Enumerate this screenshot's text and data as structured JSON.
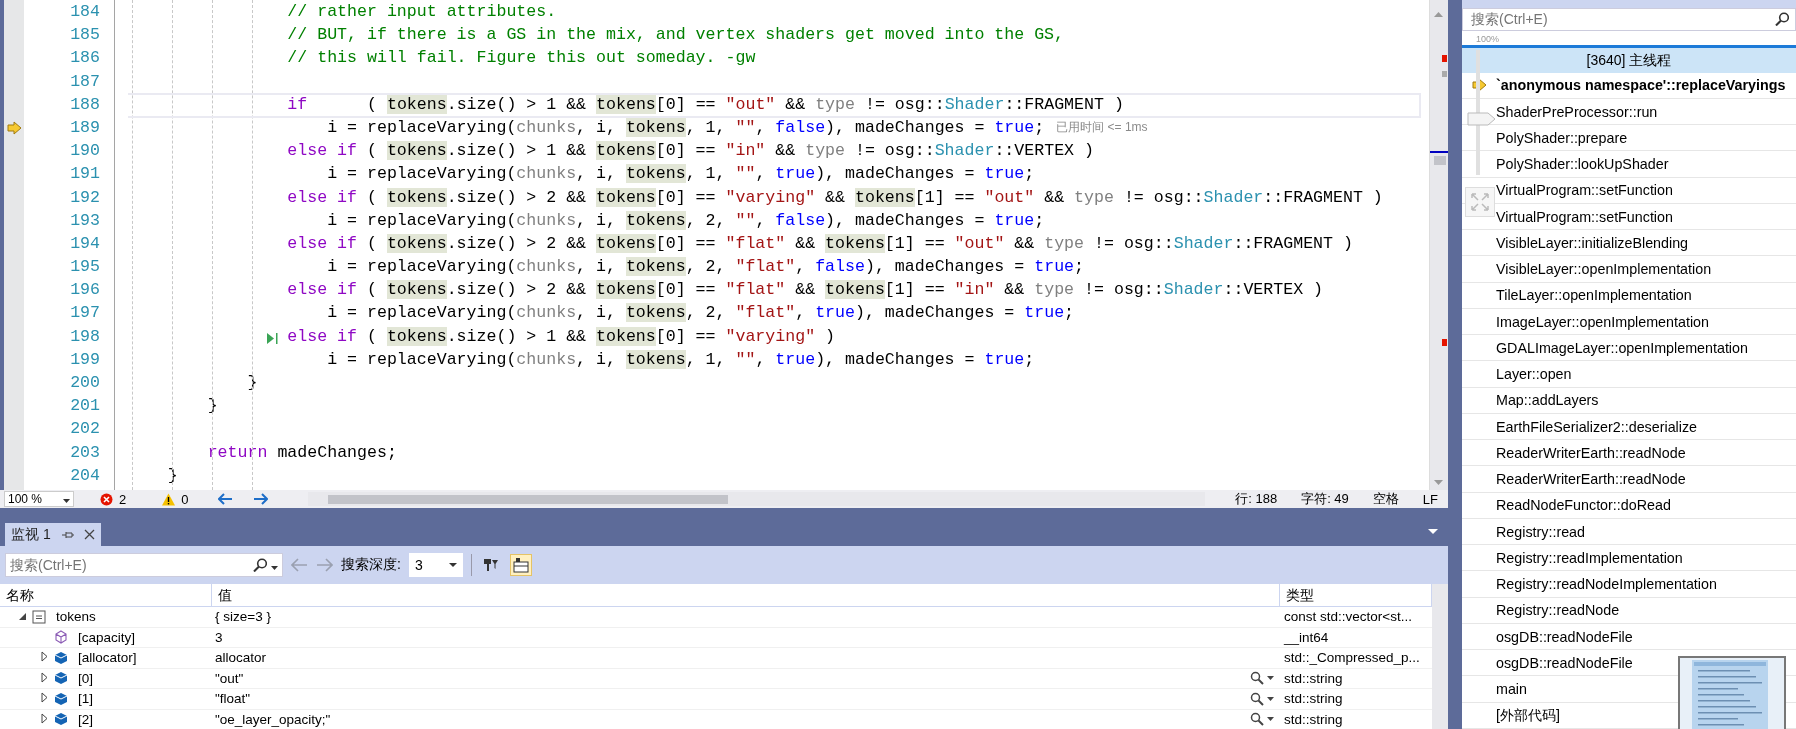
{
  "editor": {
    "lines": [
      {
        "n": "184",
        "current": false,
        "execution_point": false,
        "run_to_click": false,
        "segs": [
          {
            "kind": "comment",
            "text": "                // rather input attributes."
          }
        ]
      },
      {
        "n": "185",
        "current": false,
        "execution_point": false,
        "run_to_click": false,
        "segs": [
          {
            "kind": "comment",
            "text": "                // BUT, if there is a GS in the mix, and vertex shaders get moved into the GS,"
          }
        ]
      },
      {
        "n": "186",
        "current": false,
        "execution_point": false,
        "run_to_click": false,
        "segs": [
          {
            "kind": "comment",
            "text": "                // this will fail. Figure this out someday. -gw"
          }
        ]
      },
      {
        "n": "187",
        "current": false,
        "execution_point": false,
        "run_to_click": false
      },
      {
        "n": "188",
        "current": true,
        "execution_point": false,
        "run_to_click": false,
        "segs": [
          {
            "kind": "control",
            "text": "                if"
          },
          {
            "kind": "plain",
            "text": "      ( "
          },
          {
            "kind": "match",
            "text": "tokens"
          },
          {
            "kind": "plain",
            "text": ".size() > 1 && "
          },
          {
            "kind": "match",
            "text": "tokens"
          },
          {
            "kind": "plain",
            "text": "[0] == "
          },
          {
            "kind": "string",
            "text": "\"out\""
          },
          {
            "kind": "plain",
            "text": " && "
          },
          {
            "kind": "param",
            "text": "type"
          },
          {
            "kind": "plain",
            "text": " != osg::"
          },
          {
            "kind": "type",
            "text": "Shader"
          },
          {
            "kind": "plain",
            "text": "::FRAGMENT )"
          }
        ]
      },
      {
        "n": "189",
        "current": false,
        "execution_point": true,
        "run_to_click": false,
        "perf_tip": "已用时间 <= 1ms",
        "segs": [
          {
            "kind": "plain",
            "text": "                    i = replaceVarying("
          },
          {
            "kind": "param",
            "text": "chunks"
          },
          {
            "kind": "plain",
            "text": ", i, "
          },
          {
            "kind": "match",
            "text": "tokens"
          },
          {
            "kind": "plain",
            "text": ", 1, "
          },
          {
            "kind": "string",
            "text": "\"\""
          },
          {
            "kind": "plain",
            "text": ", "
          },
          {
            "kind": "keyword",
            "text": "false"
          },
          {
            "kind": "plain",
            "text": "), madeChanges = "
          },
          {
            "kind": "keyword",
            "text": "true"
          },
          {
            "kind": "plain",
            "text": ";"
          }
        ]
      },
      {
        "n": "190",
        "current": false,
        "execution_point": false,
        "run_to_click": false,
        "segs": [
          {
            "kind": "control",
            "text": "                else if"
          },
          {
            "kind": "plain",
            "text": " ( "
          },
          {
            "kind": "match",
            "text": "tokens"
          },
          {
            "kind": "plain",
            "text": ".size() > 1 && "
          },
          {
            "kind": "match",
            "text": "tokens"
          },
          {
            "kind": "plain",
            "text": "[0] == "
          },
          {
            "kind": "string",
            "text": "\"in\""
          },
          {
            "kind": "plain",
            "text": " && "
          },
          {
            "kind": "param",
            "text": "type"
          },
          {
            "kind": "plain",
            "text": " != osg::"
          },
          {
            "kind": "type",
            "text": "Shader"
          },
          {
            "kind": "plain",
            "text": "::VERTEX )"
          }
        ]
      },
      {
        "n": "191",
        "current": false,
        "execution_point": false,
        "run_to_click": false,
        "segs": [
          {
            "kind": "plain",
            "text": "                    i = replaceVarying("
          },
          {
            "kind": "param",
            "text": "chunks"
          },
          {
            "kind": "plain",
            "text": ", i, "
          },
          {
            "kind": "match",
            "text": "tokens"
          },
          {
            "kind": "plain",
            "text": ", 1, "
          },
          {
            "kind": "string",
            "text": "\"\""
          },
          {
            "kind": "plain",
            "text": ", "
          },
          {
            "kind": "keyword",
            "text": "true"
          },
          {
            "kind": "plain",
            "text": "), madeChanges = "
          },
          {
            "kind": "keyword",
            "text": "true"
          },
          {
            "kind": "plain",
            "text": ";"
          }
        ]
      },
      {
        "n": "192",
        "current": false,
        "execution_point": false,
        "run_to_click": false,
        "segs": [
          {
            "kind": "control",
            "text": "                else if"
          },
          {
            "kind": "plain",
            "text": " ( "
          },
          {
            "kind": "match",
            "text": "tokens"
          },
          {
            "kind": "plain",
            "text": ".size() > 2 && "
          },
          {
            "kind": "match",
            "text": "tokens"
          },
          {
            "kind": "plain",
            "text": "[0] == "
          },
          {
            "kind": "string",
            "text": "\"varying\""
          },
          {
            "kind": "plain",
            "text": " && "
          },
          {
            "kind": "match",
            "text": "tokens"
          },
          {
            "kind": "plain",
            "text": "[1] == "
          },
          {
            "kind": "string",
            "text": "\"out\""
          },
          {
            "kind": "plain",
            "text": " && "
          },
          {
            "kind": "param",
            "text": "type"
          },
          {
            "kind": "plain",
            "text": " != osg::"
          },
          {
            "kind": "type",
            "text": "Shader"
          },
          {
            "kind": "plain",
            "text": "::FRAGMENT )"
          }
        ]
      },
      {
        "n": "193",
        "current": false,
        "execution_point": false,
        "run_to_click": false,
        "segs": [
          {
            "kind": "plain",
            "text": "                    i = replaceVarying("
          },
          {
            "kind": "param",
            "text": "chunks"
          },
          {
            "kind": "plain",
            "text": ", i, "
          },
          {
            "kind": "match",
            "text": "tokens"
          },
          {
            "kind": "plain",
            "text": ", 2, "
          },
          {
            "kind": "string",
            "text": "\"\""
          },
          {
            "kind": "plain",
            "text": ", "
          },
          {
            "kind": "keyword",
            "text": "false"
          },
          {
            "kind": "plain",
            "text": "), madeChanges = "
          },
          {
            "kind": "keyword",
            "text": "true"
          },
          {
            "kind": "plain",
            "text": ";"
          }
        ]
      },
      {
        "n": "194",
        "current": false,
        "execution_point": false,
        "run_to_click": false,
        "segs": [
          {
            "kind": "control",
            "text": "                else if"
          },
          {
            "kind": "plain",
            "text": " ( "
          },
          {
            "kind": "match",
            "text": "tokens"
          },
          {
            "kind": "plain",
            "text": ".size() > 2 && "
          },
          {
            "kind": "match",
            "text": "tokens"
          },
          {
            "kind": "plain",
            "text": "[0] == "
          },
          {
            "kind": "string",
            "text": "\"flat\""
          },
          {
            "kind": "plain",
            "text": " && "
          },
          {
            "kind": "match",
            "text": "tokens"
          },
          {
            "kind": "plain",
            "text": "[1] == "
          },
          {
            "kind": "string",
            "text": "\"out\""
          },
          {
            "kind": "plain",
            "text": " && "
          },
          {
            "kind": "param",
            "text": "type"
          },
          {
            "kind": "plain",
            "text": " != osg::"
          },
          {
            "kind": "type",
            "text": "Shader"
          },
          {
            "kind": "plain",
            "text": "::FRAGMENT )"
          }
        ]
      },
      {
        "n": "195",
        "current": false,
        "execution_point": false,
        "run_to_click": false,
        "segs": [
          {
            "kind": "plain",
            "text": "                    i = replaceVarying("
          },
          {
            "kind": "param",
            "text": "chunks"
          },
          {
            "kind": "plain",
            "text": ", i, "
          },
          {
            "kind": "match",
            "text": "tokens"
          },
          {
            "kind": "plain",
            "text": ", 2, "
          },
          {
            "kind": "string",
            "text": "\"flat\""
          },
          {
            "kind": "plain",
            "text": ", "
          },
          {
            "kind": "keyword",
            "text": "false"
          },
          {
            "kind": "plain",
            "text": "), madeChanges = "
          },
          {
            "kind": "keyword",
            "text": "true"
          },
          {
            "kind": "plain",
            "text": ";"
          }
        ]
      },
      {
        "n": "196",
        "current": false,
        "execution_point": false,
        "run_to_click": false,
        "segs": [
          {
            "kind": "control",
            "text": "                else if"
          },
          {
            "kind": "plain",
            "text": " ( "
          },
          {
            "kind": "match",
            "text": "tokens"
          },
          {
            "kind": "plain",
            "text": ".size() > 2 && "
          },
          {
            "kind": "match",
            "text": "tokens"
          },
          {
            "kind": "plain",
            "text": "[0] == "
          },
          {
            "kind": "string",
            "text": "\"flat\""
          },
          {
            "kind": "plain",
            "text": " && "
          },
          {
            "kind": "match",
            "text": "tokens"
          },
          {
            "kind": "plain",
            "text": "[1] == "
          },
          {
            "kind": "string",
            "text": "\"in\""
          },
          {
            "kind": "plain",
            "text": " && "
          },
          {
            "kind": "param",
            "text": "type"
          },
          {
            "kind": "plain",
            "text": " != osg::"
          },
          {
            "kind": "type",
            "text": "Shader"
          },
          {
            "kind": "plain",
            "text": "::VERTEX )"
          }
        ]
      },
      {
        "n": "197",
        "current": false,
        "execution_point": false,
        "run_to_click": false,
        "segs": [
          {
            "kind": "plain",
            "text": "                    i = replaceVarying("
          },
          {
            "kind": "param",
            "text": "chunks"
          },
          {
            "kind": "plain",
            "text": ", i, "
          },
          {
            "kind": "match",
            "text": "tokens"
          },
          {
            "kind": "plain",
            "text": ", 2, "
          },
          {
            "kind": "string",
            "text": "\"flat\""
          },
          {
            "kind": "plain",
            "text": ", "
          },
          {
            "kind": "keyword",
            "text": "true"
          },
          {
            "kind": "plain",
            "text": "), madeChanges = "
          },
          {
            "kind": "keyword",
            "text": "true"
          },
          {
            "kind": "plain",
            "text": ";"
          }
        ]
      },
      {
        "n": "198",
        "current": false,
        "execution_point": false,
        "run_to_click": true,
        "segs": [
          {
            "kind": "control",
            "text": "                else if"
          },
          {
            "kind": "plain",
            "text": " ( "
          },
          {
            "kind": "match",
            "text": "tokens"
          },
          {
            "kind": "plain",
            "text": ".size() > 1 && "
          },
          {
            "kind": "match",
            "text": "tokens"
          },
          {
            "kind": "plain",
            "text": "[0] == "
          },
          {
            "kind": "string",
            "text": "\"varying\""
          },
          {
            "kind": "plain",
            "text": " )"
          }
        ]
      },
      {
        "n": "199",
        "current": false,
        "execution_point": false,
        "run_to_click": false,
        "segs": [
          {
            "kind": "plain",
            "text": "                    i = replaceVarying("
          },
          {
            "kind": "param",
            "text": "chunks"
          },
          {
            "kind": "plain",
            "text": ", i, "
          },
          {
            "kind": "match",
            "text": "tokens"
          },
          {
            "kind": "plain",
            "text": ", 1, "
          },
          {
            "kind": "string",
            "text": "\"\""
          },
          {
            "kind": "plain",
            "text": ", "
          },
          {
            "kind": "keyword",
            "text": "true"
          },
          {
            "kind": "plain",
            "text": "), madeChanges = "
          },
          {
            "kind": "keyword",
            "text": "true"
          },
          {
            "kind": "plain",
            "text": ";"
          }
        ]
      },
      {
        "n": "200",
        "current": false,
        "execution_point": false,
        "run_to_click": false,
        "segs": [
          {
            "kind": "plain",
            "text": "            }"
          }
        ]
      },
      {
        "n": "201",
        "current": false,
        "execution_point": false,
        "run_to_click": false,
        "segs": [
          {
            "kind": "plain",
            "text": "        }"
          }
        ]
      },
      {
        "n": "202",
        "current": false,
        "execution_point": false,
        "run_to_click": false
      },
      {
        "n": "203",
        "current": false,
        "execution_point": false,
        "run_to_click": false,
        "segs": [
          {
            "kind": "control",
            "text": "        return"
          },
          {
            "kind": "plain",
            "text": " madeChanges;"
          }
        ]
      },
      {
        "n": "204",
        "current": false,
        "execution_point": false,
        "run_to_click": false,
        "segs": [
          {
            "kind": "plain",
            "text": "    }"
          }
        ]
      }
    ]
  },
  "editor_status": {
    "zoom": "100 %",
    "errors": "2",
    "warnings": "0",
    "line": "行: 188",
    "char": "字符: 49",
    "whitespace": "空格",
    "line_ending": "LF"
  },
  "watch": {
    "tab": {
      "label": "监视 1",
      "selected": true
    },
    "search": {
      "placeholder": "搜索(Ctrl+E)"
    },
    "depth_label": "搜索深度:",
    "depth": "3",
    "toolbar_buttons": [
      {
        "kind": "filter",
        "checked": false
      },
      {
        "kind": "grid",
        "checked": true
      }
    ],
    "columns": [
      "名称",
      "值",
      "类型"
    ],
    "rows": [
      {
        "name": "tokens",
        "value": "{ size=3 }",
        "type": "const std::vector<st...",
        "kind": "variable",
        "expandable": true,
        "expanded": true,
        "visualizer": false,
        "children": [
          {
            "name": "[capacity]",
            "value": "3",
            "type": "__int64",
            "kind": "property",
            "expandable": false,
            "visualizer": false
          },
          {
            "name": "[allocator]",
            "value": "allocator",
            "type": "std::_Compressed_p...",
            "kind": "member",
            "expandable": true,
            "expanded": false,
            "visualizer": false
          },
          {
            "name": "[0]",
            "value": "\"out\"",
            "type": "std::string",
            "kind": "member",
            "expandable": true,
            "expanded": false,
            "visualizer": true
          },
          {
            "name": "[1]",
            "value": "\"float\"",
            "type": "std::string",
            "kind": "member",
            "expandable": true,
            "expanded": false,
            "visualizer": true
          },
          {
            "name": "[2]",
            "value": "\"oe_layer_opacity;\"",
            "type": "std::string",
            "kind": "member",
            "expandable": true,
            "expanded": false,
            "visualizer": true
          }
        ]
      }
    ]
  },
  "call_stack": {
    "search": {
      "placeholder": "搜索(Ctrl+E)"
    },
    "zoom": "100%",
    "thread": "[3640] 主线程",
    "frames": [
      {
        "name": "`anonymous namespace'::replaceVaryings",
        "current": true
      },
      {
        "name": "ShaderPreProcessor::run",
        "current": false
      },
      {
        "name": "PolyShader::prepare",
        "current": false
      },
      {
        "name": "PolyShader::lookUpShader",
        "current": false
      },
      {
        "name": "VirtualProgram::setFunction",
        "current": false
      },
      {
        "name": "VirtualProgram::setFunction",
        "current": false
      },
      {
        "name": "VisibleLayer::initializeBlending",
        "current": false
      },
      {
        "name": "VisibleLayer::openImplementation",
        "current": false
      },
      {
        "name": "TileLayer::openImplementation",
        "current": false
      },
      {
        "name": "ImageLayer::openImplementation",
        "current": false
      },
      {
        "name": "GDALImageLayer::openImplementation",
        "current": false
      },
      {
        "name": "Layer::open",
        "current": false
      },
      {
        "name": "Map::addLayers",
        "current": false
      },
      {
        "name": "EarthFileSerializer2::deserialize",
        "current": false
      },
      {
        "name": "ReaderWriterEarth::readNode",
        "current": false
      },
      {
        "name": "ReaderWriterEarth::readNode",
        "current": false
      },
      {
        "name": "ReadNodeFunctor::doRead",
        "current": false
      },
      {
        "name": "Registry::read",
        "current": false
      },
      {
        "name": "Registry::readImplementation",
        "current": false
      },
      {
        "name": "Registry::readNodeImplementation",
        "current": false
      },
      {
        "name": "Registry::readNode",
        "current": false
      },
      {
        "name": "osgDB::readNodeFile",
        "current": false
      },
      {
        "name": "osgDB::readNodeFile",
        "current": false
      },
      {
        "name": "main",
        "current": false
      },
      {
        "name": "[外部代码]",
        "current": false
      }
    ]
  }
}
